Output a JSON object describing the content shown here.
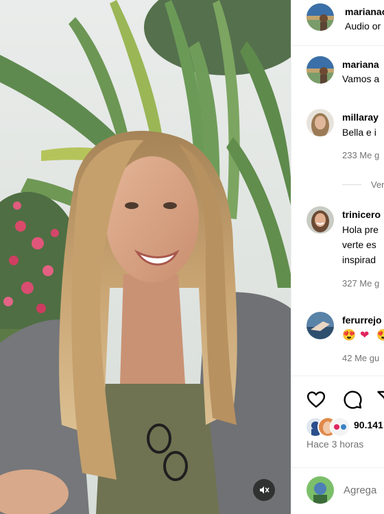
{
  "post": {
    "author": "marianao",
    "subtitle": "Audio or",
    "time_ago": "Hace 3 horas",
    "likes_partial": "90.141"
  },
  "caption": {
    "username": "mariana",
    "text": "Vamos a"
  },
  "comments": [
    {
      "username": "millaray",
      "lines": [
        "Bella e i"
      ],
      "likes": "233 Me g"
    },
    {
      "username": "trinicero",
      "lines": [
        "Hola pre",
        "verte es",
        "inspirad"
      ],
      "likes": "327 Me g"
    },
    {
      "username": "ferurrejo",
      "likes": "42 Me gu"
    }
  ],
  "view_replies": "Ver",
  "emoji_line": [
    "😍",
    "❤",
    "😍"
  ],
  "comment_input": {
    "placeholder": "Agrega"
  },
  "icons": [
    "heart-icon",
    "comment-icon",
    "share-icon",
    "mute-icon"
  ]
}
